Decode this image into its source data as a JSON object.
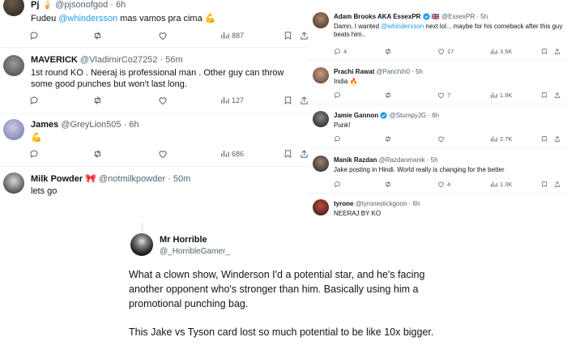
{
  "left": {
    "tweets": [
      {
        "name": "Pj",
        "emoji": "🍦",
        "handle": "@pjsonofgod",
        "sep": "·",
        "time": "6h",
        "text_pre": "Fudeu ",
        "mention": "@whindersson",
        "text_post": " mas vamos pra cima ",
        "text_emoji": "💪",
        "views": "887"
      },
      {
        "name": "MAVERICK",
        "handle": "@VladimirCo27252",
        "sep": "·",
        "time": "56m",
        "text": "1st round KO . Neeraj is professional man . Other guy can throw some good punches but won't last long.",
        "views": "127"
      },
      {
        "name": "James",
        "handle": "@GreyLion505",
        "sep": "·",
        "time": "6h",
        "text_emoji": "💪",
        "views": "686"
      },
      {
        "name": "Milk Powder",
        "emoji": "🎀",
        "handle": "@notmilkpowder",
        "sep": "·",
        "time": "50m",
        "text": "lets go"
      }
    ]
  },
  "right": {
    "tweets": [
      {
        "name": "Adam Brooks AKA EssexPR",
        "flag": "🇬🇧",
        "handle": "@EssexPR",
        "sep": "·",
        "time": "5h",
        "text_pre": "Damn, I wanted ",
        "mention": "@whindersson",
        "text_post": " next lol... maybe for his comeback after this guy beats him..",
        "replies": "4",
        "likes": "17",
        "views": "3.5K"
      },
      {
        "name": "Prachi Rawat",
        "handle": "@Panchih0",
        "sep": "·",
        "time": "5h",
        "text": "India ",
        "text_emoji": "🔥",
        "likes": "7",
        "views": "1.9K"
      },
      {
        "name": "Jamie Gannon",
        "handle": "@StumpyJG",
        "sep": "·",
        "time": "6h",
        "text": "Punk!",
        "views": "2.7K"
      },
      {
        "name": "Manik Razdan",
        "handle": "@Razdanmanik",
        "sep": "·",
        "time": "5h",
        "text": "Jake posting in Hindi. World really is changing for the better",
        "likes": "4",
        "views": "1.3K"
      },
      {
        "name": "tyrone",
        "handle": "@tyroneslickgoon",
        "sep": "·",
        "time": "6h",
        "text": "NEERAJ BY KO"
      }
    ]
  },
  "bottom": {
    "name": "Mr Horrible",
    "handle": "@_HorribleGamer_",
    "para1": "What a clown show, Winderson I'd a potential star, and he's facing another opponent who's stronger than him. Basically using him a promotional punching bag.",
    "para2": "This Jake vs Tyson card lost so much potential to be like 10x bigger."
  },
  "colors": {
    "accent": "#1d9bf0",
    "muted": "#536471",
    "divider": "#eff3f4",
    "text": "#0f1419"
  },
  "icons": [
    "reply-icon",
    "retweet-icon",
    "like-icon",
    "views-icon",
    "bookmark-icon",
    "share-icon",
    "verified-icon"
  ]
}
